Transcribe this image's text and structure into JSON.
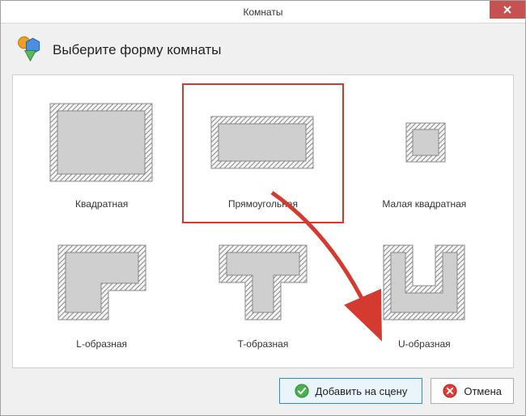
{
  "window": {
    "title": "Комнаты"
  },
  "header": {
    "heading": "Выберите форму комнаты"
  },
  "shapes": [
    {
      "id": "square",
      "label": "Квадратная",
      "selected": false
    },
    {
      "id": "rectangle",
      "label": "Прямоугольная",
      "selected": true
    },
    {
      "id": "small-square",
      "label": "Малая квадратная",
      "selected": false
    },
    {
      "id": "l-shape",
      "label": "L-образная",
      "selected": false
    },
    {
      "id": "t-shape",
      "label": "T-образная",
      "selected": false
    },
    {
      "id": "u-shape",
      "label": "U-образная",
      "selected": false
    }
  ],
  "footer": {
    "primary_label": "Добавить на сцену",
    "cancel_label": "Отмена"
  },
  "colors": {
    "accent_red": "#d43a2f",
    "wall_fill": "#cfcfcf",
    "wall_stroke": "#7a7a7a"
  }
}
